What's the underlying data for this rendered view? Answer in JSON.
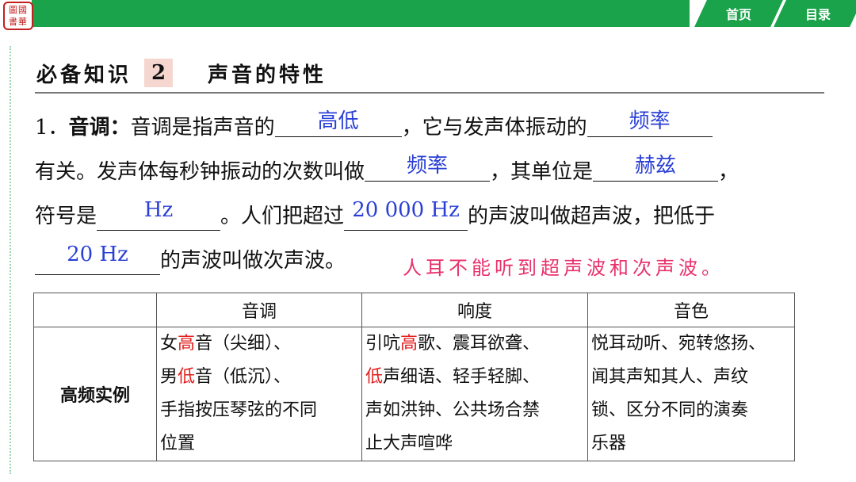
{
  "logo": {
    "glyphs": "圖國書華"
  },
  "nav": {
    "home": "首页",
    "toc": "目录"
  },
  "section": {
    "label": "必备知识",
    "number": "2",
    "name": "声音的特性"
  },
  "para": {
    "item_no": "1．",
    "term": "音调：",
    "l1_a": "音调是指声音的",
    "blank1": "高低",
    "l1_b": "，它与发声体振动的",
    "blank2": "频率",
    "l2_a": "有关。发声体每秒钟振动的次数叫做",
    "blank3": "频率",
    "l2_b": "，其单位是",
    "blank4": "赫兹",
    "l2_c": "，",
    "l3_a": "符号是",
    "blank5": "Hz",
    "l3_b": "。人们把超过",
    "blank6": "20 000 Hz",
    "l3_c": "的声波叫做超声波，把低于",
    "blank7": "20 Hz",
    "l4_a": "的声波叫做次声波。",
    "note": "人耳不能听到超声波和次声波。"
  },
  "table": {
    "headers": [
      "",
      "音调",
      "响度",
      "音色"
    ],
    "row_label": "高频实例",
    "pitch": {
      "l1_a": "女",
      "l1_red": "高",
      "l1_b": "音（尖细）、",
      "l2_a": "男",
      "l2_red": "低",
      "l2_b": "音（低沉）、",
      "l3": "手指按压琴弦的不同",
      "l4": "位置"
    },
    "loudness": {
      "l1_a": "引吭",
      "l1_red": "高",
      "l1_b": "歌、震耳欲聋、",
      "l2_red": "低",
      "l2_b": "声细语、轻手轻脚、",
      "l3": "声如洪钟、公共场合禁",
      "l4": "止大声喧哗"
    },
    "timbre": {
      "l1": "悦耳动听、宛转悠扬、",
      "l2": "闻其声知其人、声纹",
      "l3": "锁、区分不同的演奏",
      "l4": "乐器"
    }
  },
  "colors": {
    "green": "#1aa34a",
    "answer_blue": "#2a3fd6",
    "note_pink": "#e8316b",
    "emphasis_red": "#e21d1d"
  }
}
